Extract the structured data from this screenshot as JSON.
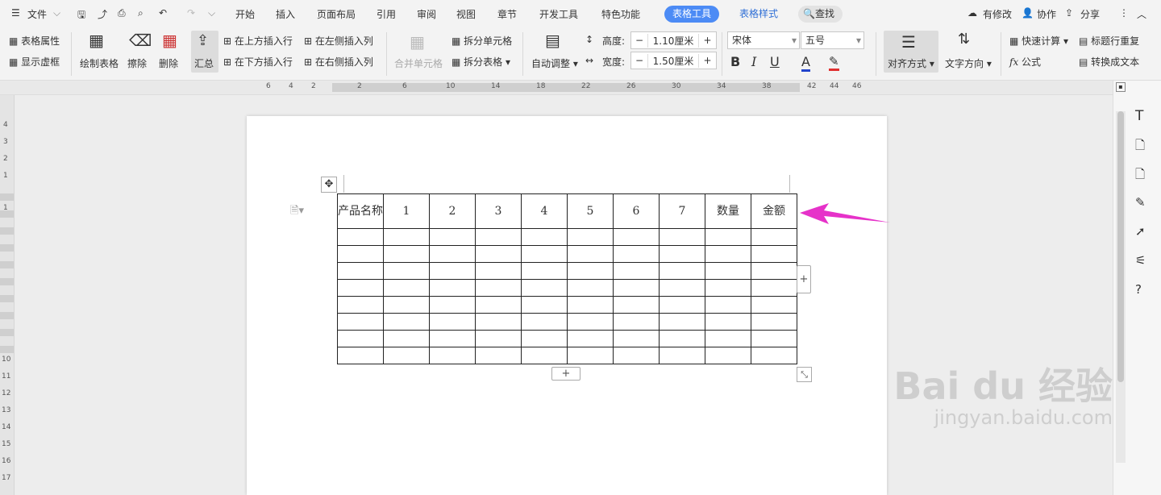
{
  "menu": {
    "file": "文件",
    "tabs": [
      "开始",
      "插入",
      "页面布局",
      "引用",
      "审阅",
      "视图",
      "章节",
      "开发工具",
      "特色功能"
    ],
    "active_tab": "表格工具",
    "style_tab": "表格样式",
    "search": "查找",
    "modified": "有修改",
    "collab": "协作",
    "share": "分享"
  },
  "ribbon": {
    "table_props": "表格属性",
    "show_grid": "显示虚框",
    "draw_table": "绘制表格",
    "erase": "擦除",
    "delete": "删除",
    "summary": "汇总",
    "insert_row_above": "在上方插入行",
    "insert_row_below": "在下方插入行",
    "insert_col_left": "在左侧插入列",
    "insert_col_right": "在右侧插入列",
    "merge_cells": "合并单元格",
    "split_cells": "拆分单元格",
    "split_table": "拆分表格",
    "auto_fit": "自动调整",
    "height_label": "高度:",
    "height_value": "1.10厘米",
    "width_label": "宽度:",
    "width_value": "1.50厘米",
    "font_name": "宋体",
    "font_size": "五号",
    "align": "对齐方式",
    "text_dir": "文字方向",
    "quick_calc": "快速计算",
    "repeat_header": "标题行重复",
    "formula": "公式",
    "to_text": "转换成文本"
  },
  "ruler": {
    "h_ticks": [
      "6",
      "4",
      "2",
      "2",
      "6",
      "10",
      "14",
      "18",
      "22",
      "26",
      "30",
      "34",
      "38",
      "42",
      "44",
      "46"
    ],
    "v_ticks": [
      "4",
      "3",
      "2",
      "1",
      "1",
      "10",
      "11",
      "12",
      "13",
      "14",
      "15",
      "16",
      "17"
    ]
  },
  "table": {
    "header": [
      "产品名称",
      "1",
      "2",
      "3",
      "4",
      "5",
      "6",
      "7",
      "数量",
      "金额"
    ],
    "empty_rows": 8
  },
  "colors": {
    "accent": "#4c8bf5",
    "arrow": "#e632c9"
  },
  "watermark": {
    "line1": "Bai du 经验",
    "line2": "jingyan.baidu.com"
  }
}
